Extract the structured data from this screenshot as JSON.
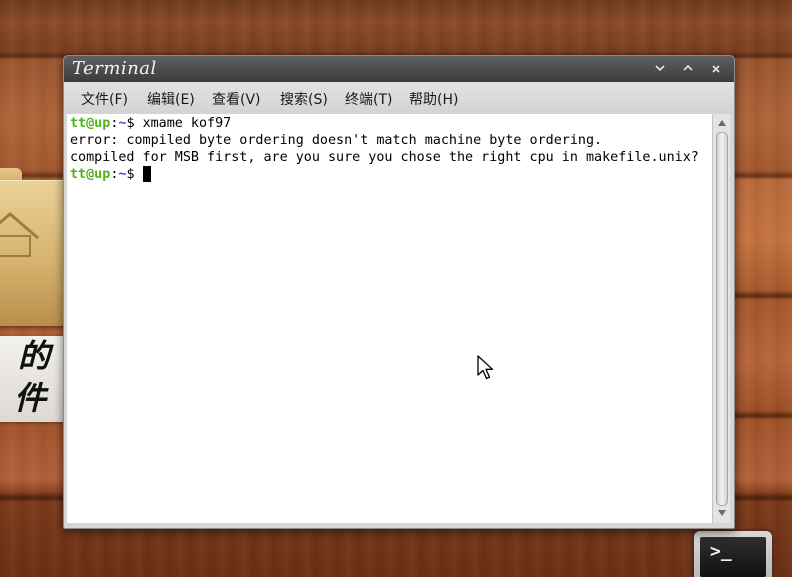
{
  "window": {
    "title": "Terminal"
  },
  "menubar": {
    "items": [
      {
        "label": "文件(F)"
      },
      {
        "label": "编辑(E)"
      },
      {
        "label": "查看(V)"
      },
      {
        "label": "搜索(S)"
      },
      {
        "label": "终端(T)"
      },
      {
        "label": "帮助(H)"
      }
    ]
  },
  "terminal": {
    "prompt_user": "tt@up",
    "prompt_sep": ":",
    "prompt_dir": "~",
    "prompt_symbol": "$ ",
    "command": "xmame kof97",
    "output": [
      "error: compiled byte ordering doesn't match machine byte ordering.",
      "compiled for MSB first, are you sure you chose the right cpu in makefile.unix?"
    ]
  },
  "desktop": {
    "banner_glyphs": [
      "的",
      "件"
    ],
    "dock_terminal_prompt": ">_"
  },
  "icons": {
    "minimize": "chevron-down-icon",
    "maximize": "chevron-up-icon",
    "close": "close-icon",
    "scroll_up": "arrow-up-icon",
    "scroll_down": "arrow-down-icon",
    "pointer": "mouse-pointer-icon"
  },
  "colors": {
    "prompt_user": "#4fb320",
    "prompt_dir": "#3a4fd6",
    "titlebar": "#4a4a4a",
    "terminal_bg": "#ffffff"
  }
}
